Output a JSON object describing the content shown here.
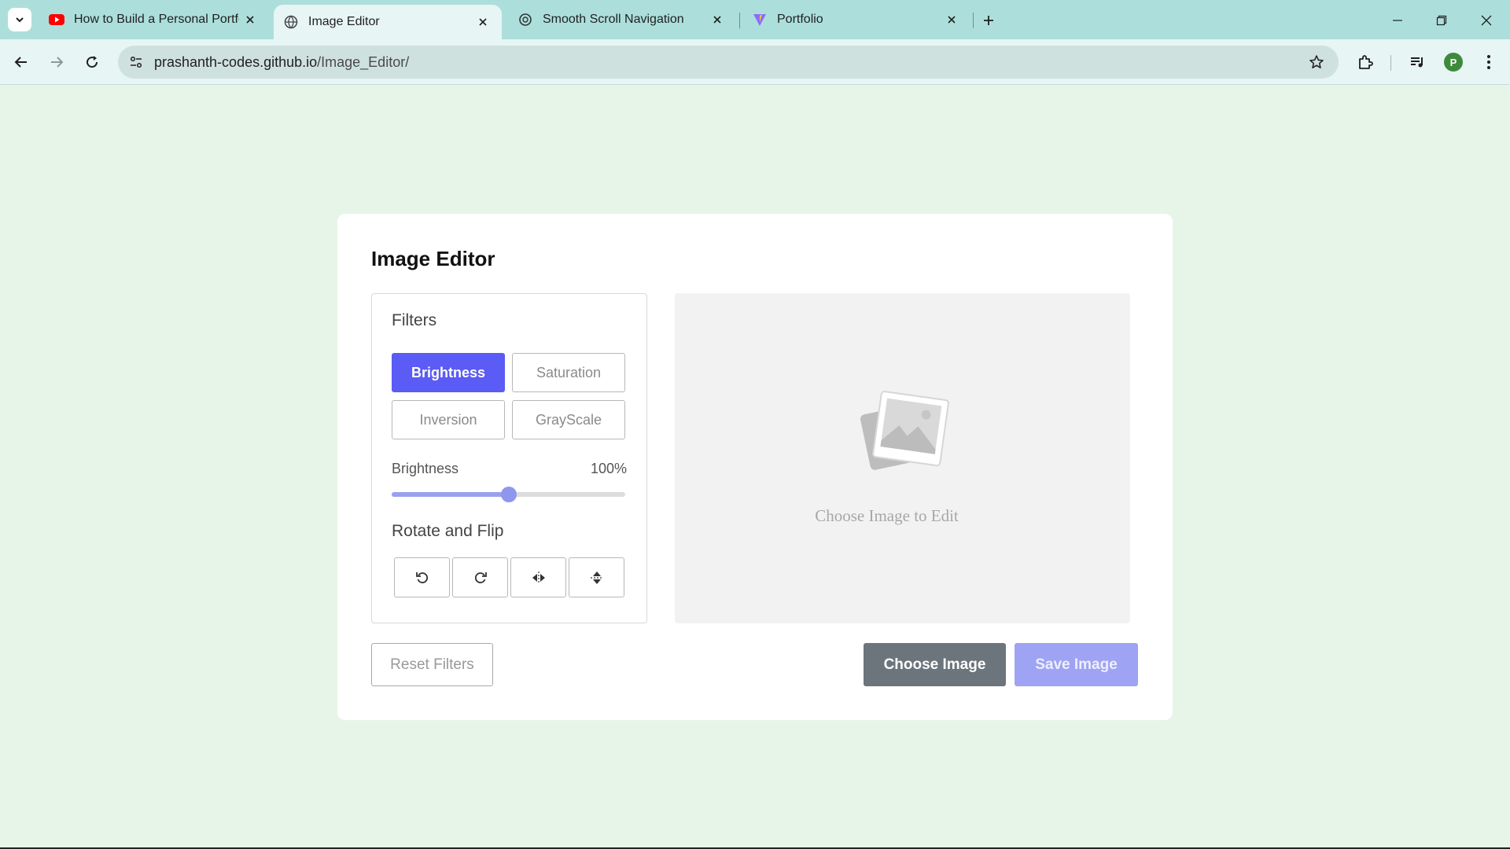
{
  "browser": {
    "tabs": [
      {
        "title": "How to Build a Personal Portfoli",
        "favicon": "youtube-icon",
        "active": false
      },
      {
        "title": "Image Editor",
        "favicon": "globe-icon",
        "active": true
      },
      {
        "title": "Smooth Scroll Navigation",
        "favicon": "openai-icon",
        "active": false
      },
      {
        "title": "Portfolio",
        "favicon": "vite-icon",
        "active": false
      }
    ],
    "url_host": "prashanth-codes.github.io",
    "url_path": "/Image_Editor/",
    "profile_initial": "P"
  },
  "editor": {
    "title": "Image Editor",
    "filters_title": "Filters",
    "filter_buttons": [
      "Brightness",
      "Saturation",
      "Inversion",
      "GrayScale"
    ],
    "active_filter": "Brightness",
    "slider": {
      "label": "Brightness",
      "value_text": "100%",
      "fraction": 0.5
    },
    "rotate_title": "Rotate and Flip",
    "rotate_icons": [
      "rotate-left-icon",
      "rotate-right-icon",
      "flip-horizontal-icon",
      "flip-vertical-icon"
    ],
    "preview_text": "Choose Image to Edit",
    "reset_label": "Reset Filters",
    "choose_label": "Choose Image",
    "save_label": "Save Image"
  },
  "colors": {
    "accent": "#5b5bf5",
    "page_bg": "#e7f5e8",
    "tabstrip_bg": "#acdfdc"
  }
}
